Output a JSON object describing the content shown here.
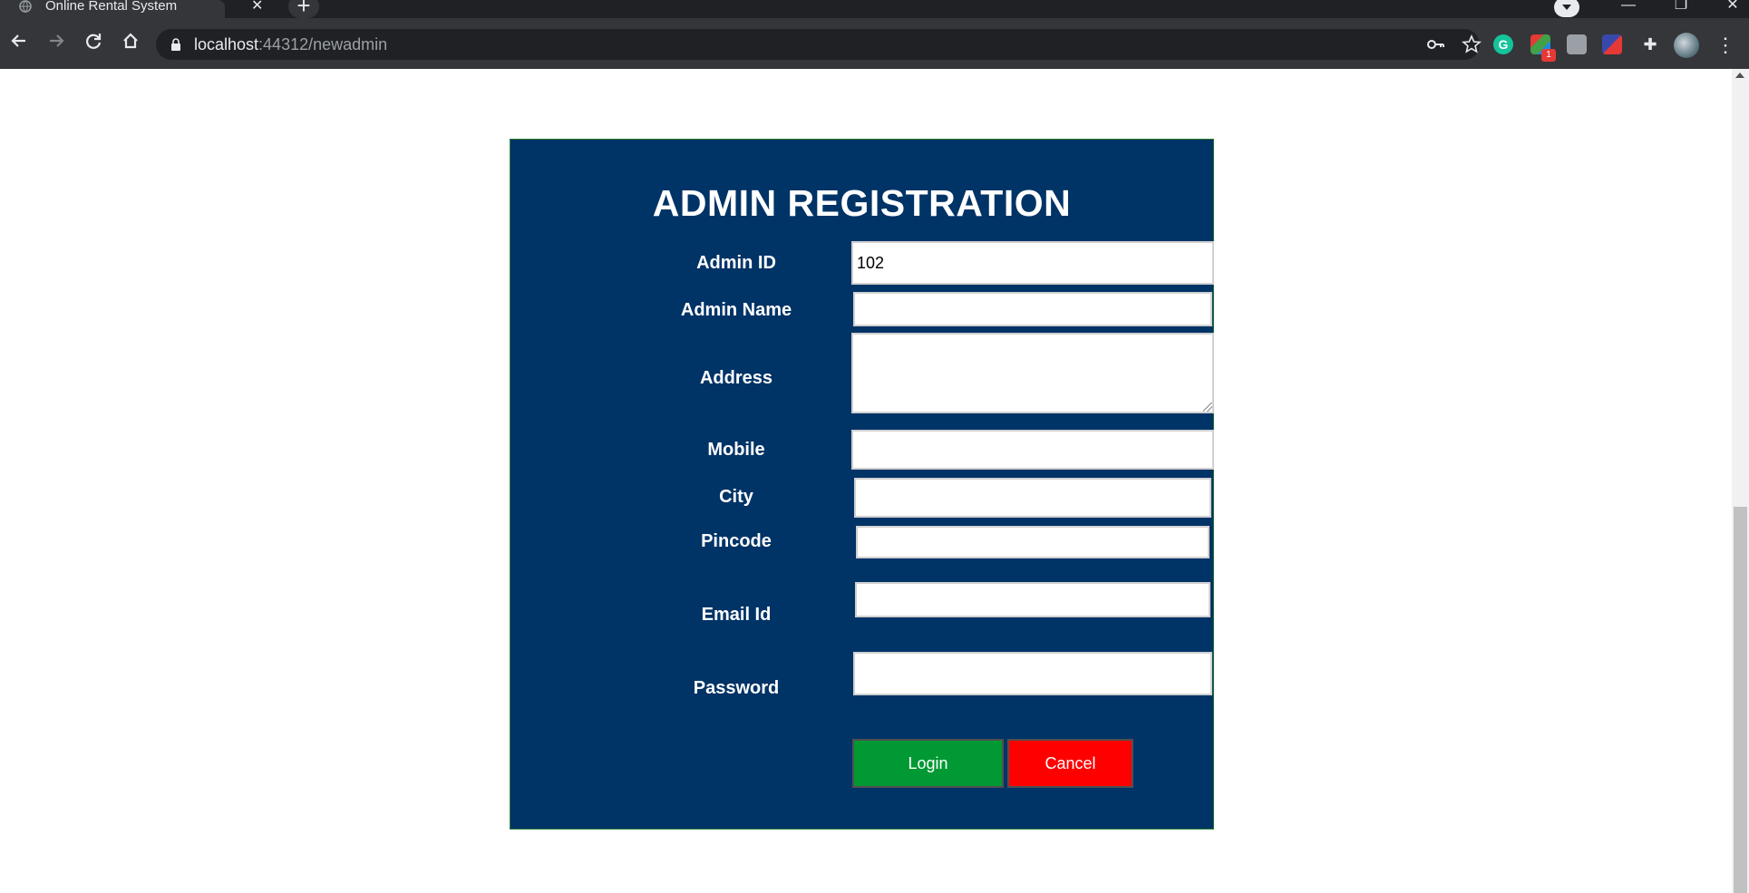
{
  "browser": {
    "tab_title": "Online Rental System",
    "tab_close": "✕",
    "new_tab": "+",
    "url_host": "localhost",
    "url_path": ":44312/newadmin",
    "window_controls": [
      "—",
      "❐",
      "✕"
    ],
    "extension_badge": "1",
    "grammarly_letter": "G",
    "puzzle_glyph": "✚",
    "menu_glyph": "⋮"
  },
  "form": {
    "title": "ADMIN REGISTRATION",
    "labels": {
      "admin_id": "Admin ID",
      "admin_name": "Admin Name",
      "address": "Address",
      "mobile": "Mobile",
      "city": "City",
      "pincode": "Pincode",
      "email": "Email Id",
      "password": "Password"
    },
    "values": {
      "admin_id": "102",
      "admin_name": "",
      "address": "",
      "mobile": "",
      "city": "",
      "pincode": "",
      "email": "",
      "password": ""
    },
    "login_label": "Login",
    "cancel_label": "Cancel"
  },
  "colors": {
    "panel_bg": "#003366",
    "login_bg": "#009933",
    "cancel_bg": "#ff0000",
    "chrome_dark": "#202124",
    "chrome_toolbar": "#35363a"
  },
  "icons": [
    "globe-icon",
    "back-arrow-icon",
    "forward-arrow-icon",
    "reload-icon",
    "home-icon",
    "lock-icon",
    "key-icon",
    "star-icon",
    "grammarly-icon",
    "puzzle-icon",
    "profile-avatar",
    "menu-icon",
    "tab-search-icon"
  ]
}
